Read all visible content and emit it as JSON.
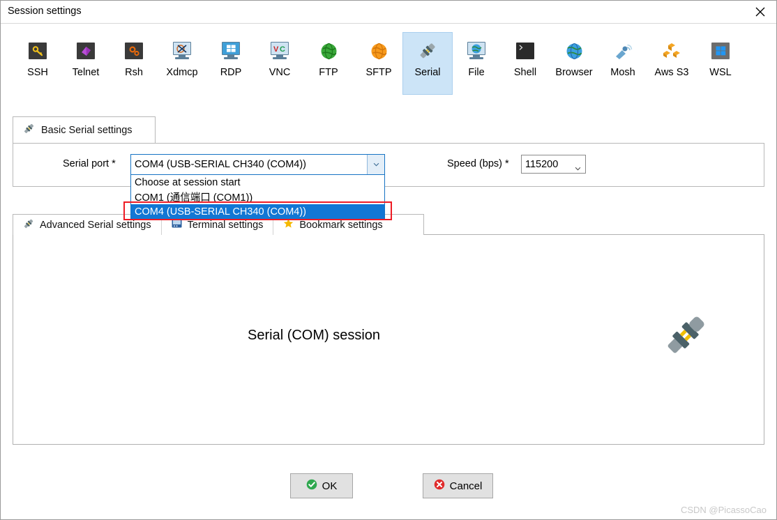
{
  "window": {
    "title": "Session settings",
    "close_icon": "close-icon"
  },
  "session_types": [
    {
      "label": "SSH",
      "icon": "ssh-key-icon",
      "selected": false
    },
    {
      "label": "Telnet",
      "icon": "telnet-icon",
      "selected": false
    },
    {
      "label": "Rsh",
      "icon": "rsh-gears-icon",
      "selected": false
    },
    {
      "label": "Xdmcp",
      "icon": "xdmcp-icon",
      "selected": false
    },
    {
      "label": "RDP",
      "icon": "rdp-windows-icon",
      "selected": false
    },
    {
      "label": "VNC",
      "icon": "vnc-icon",
      "selected": false
    },
    {
      "label": "FTP",
      "icon": "ftp-globe-icon",
      "selected": false
    },
    {
      "label": "SFTP",
      "icon": "sftp-globe-icon",
      "selected": false
    },
    {
      "label": "Serial",
      "icon": "serial-plug-icon",
      "selected": true
    },
    {
      "label": "File",
      "icon": "file-monitor-icon",
      "selected": false
    },
    {
      "label": "Shell",
      "icon": "shell-console-icon",
      "selected": false
    },
    {
      "label": "Browser",
      "icon": "browser-globe-icon",
      "selected": false
    },
    {
      "label": "Mosh",
      "icon": "mosh-satellite-icon",
      "selected": false
    },
    {
      "label": "Aws S3",
      "icon": "aws-s3-icon",
      "selected": false
    },
    {
      "label": "WSL",
      "icon": "wsl-windows-icon",
      "selected": false
    }
  ],
  "basic_tab": {
    "label": "Basic Serial settings",
    "icon": "plug-icon"
  },
  "settings": {
    "serial_port": {
      "label": "Serial port *",
      "value": "COM4  (USB-SERIAL CH340 (COM4))",
      "dropdown_open": true,
      "options": [
        "Choose at session start",
        "COM1  (通信端口 (COM1))",
        "COM4  (USB-SERIAL CH340 (COM4))"
      ],
      "selected_option_index": 2
    },
    "speed": {
      "label": "Speed (bps) *",
      "value": "115200"
    }
  },
  "sub_tabs": [
    {
      "label": "Advanced Serial settings",
      "icon": "plug-icon"
    },
    {
      "label": "Terminal settings",
      "icon": "terminal-icon"
    },
    {
      "label": "Bookmark settings",
      "icon": "star-icon"
    }
  ],
  "content": {
    "caption": "Serial (COM) session",
    "illustration_icon": "serial-plug-large-icon"
  },
  "buttons": {
    "ok": {
      "label": "OK",
      "icon": "check-circle-icon"
    },
    "cancel": {
      "label": "Cancel",
      "icon": "x-circle-icon"
    }
  },
  "watermark": "CSDN @PicassoCao",
  "colors": {
    "selection_blue": "#1277d4",
    "tab_highlight": "#cce4f7",
    "annotation_red": "#ee1b24",
    "focus_border": "#1673c4"
  }
}
